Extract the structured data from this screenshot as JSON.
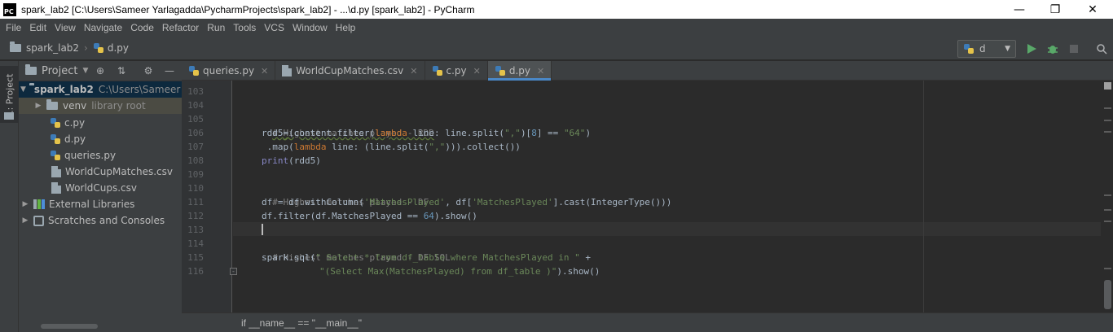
{
  "window": {
    "title": "spark_lab2 [C:\\Users\\Sameer Yarlagadda\\PycharmProjects\\spark_lab2] - ...\\d.py [spark_lab2] - PyCharm",
    "logo_text": "PC"
  },
  "menu": [
    "File",
    "Edit",
    "View",
    "Navigate",
    "Code",
    "Refactor",
    "Run",
    "Tools",
    "VCS",
    "Window",
    "Help"
  ],
  "navbar": {
    "project": "spark_lab2",
    "file": "d.py"
  },
  "run_config": {
    "name": "d"
  },
  "toolstrip": {
    "project_tab": "1: Project"
  },
  "project_panel": {
    "title": "Project",
    "tree": [
      {
        "label": "spark_lab2",
        "extra": "C:\\Users\\Sameer Y",
        "kind": "folder"
      },
      {
        "label": "venv",
        "extra": "library root",
        "kind": "folder"
      },
      {
        "label": "c.py",
        "kind": "py"
      },
      {
        "label": "d.py",
        "kind": "py"
      },
      {
        "label": "queries.py",
        "kind": "py"
      },
      {
        "label": "WorldCupMatches.csv",
        "kind": "file"
      },
      {
        "label": "WorldCups.csv",
        "kind": "file"
      },
      {
        "label": "External Libraries",
        "kind": "lib"
      },
      {
        "label": "Scratches and Consoles",
        "kind": "scratch"
      }
    ]
  },
  "editor": {
    "tabs": [
      {
        "label": "queries.py",
        "active": false
      },
      {
        "label": "WorldCupMatches.csv",
        "active": false
      },
      {
        "label": "c.py",
        "active": false
      },
      {
        "label": "d.py",
        "active": true
      }
    ],
    "line_numbers": [
      "103",
      "104",
      "105",
      "106",
      "107",
      "108",
      "109",
      "110",
      "111",
      "112",
      "113",
      "114",
      "115",
      "116"
    ],
    "code": {
      "l105": "# Highest matches played - RDD",
      "l106_a": "rdd5",
      "l106_b": "=",
      "l106_c": "(content.filter(",
      "l106_kw": "lambda",
      "l106_d": " line: line.split(",
      "l106_s1": "\",\"",
      "l106_e": ")[",
      "l106_n": "8",
      "l106_f": "] == ",
      "l106_s2": "\"64\"",
      "l106_g": ")",
      "l107_a": " .map(",
      "l107_kw": "lambda",
      "l107_b": " line: (line.split(",
      "l107_s": "\",\"",
      "l107_c": "))).collect())",
      "l108_kw": "print",
      "l108_b": "(rdd5)",
      "l110": "# Highest matches played - DF",
      "l111_a": "df = df.withColumn(",
      "l111_s1": "'MatchesPlayed'",
      "l111_b": ", df[",
      "l111_s2": "'MatchesPlayed'",
      "l111_c": "].cast(IntegerType()))",
      "l112_a": "df.filter(df.MatchesPlayed == ",
      "l112_n": "64",
      "l112_b": ").show()",
      "l114": "# Highest matches played - DF SQL",
      "l115_a": "spark.sql(",
      "l115_s": "\" Select * from df_table where MatchesPlayed in \"",
      "l115_b": " +",
      "l116_s": "\"(Select Max(MatchesPlayed) from df_table )\"",
      "l116_b": ").show()"
    }
  },
  "breadcrumb": "if __name__ == \"__main__\""
}
